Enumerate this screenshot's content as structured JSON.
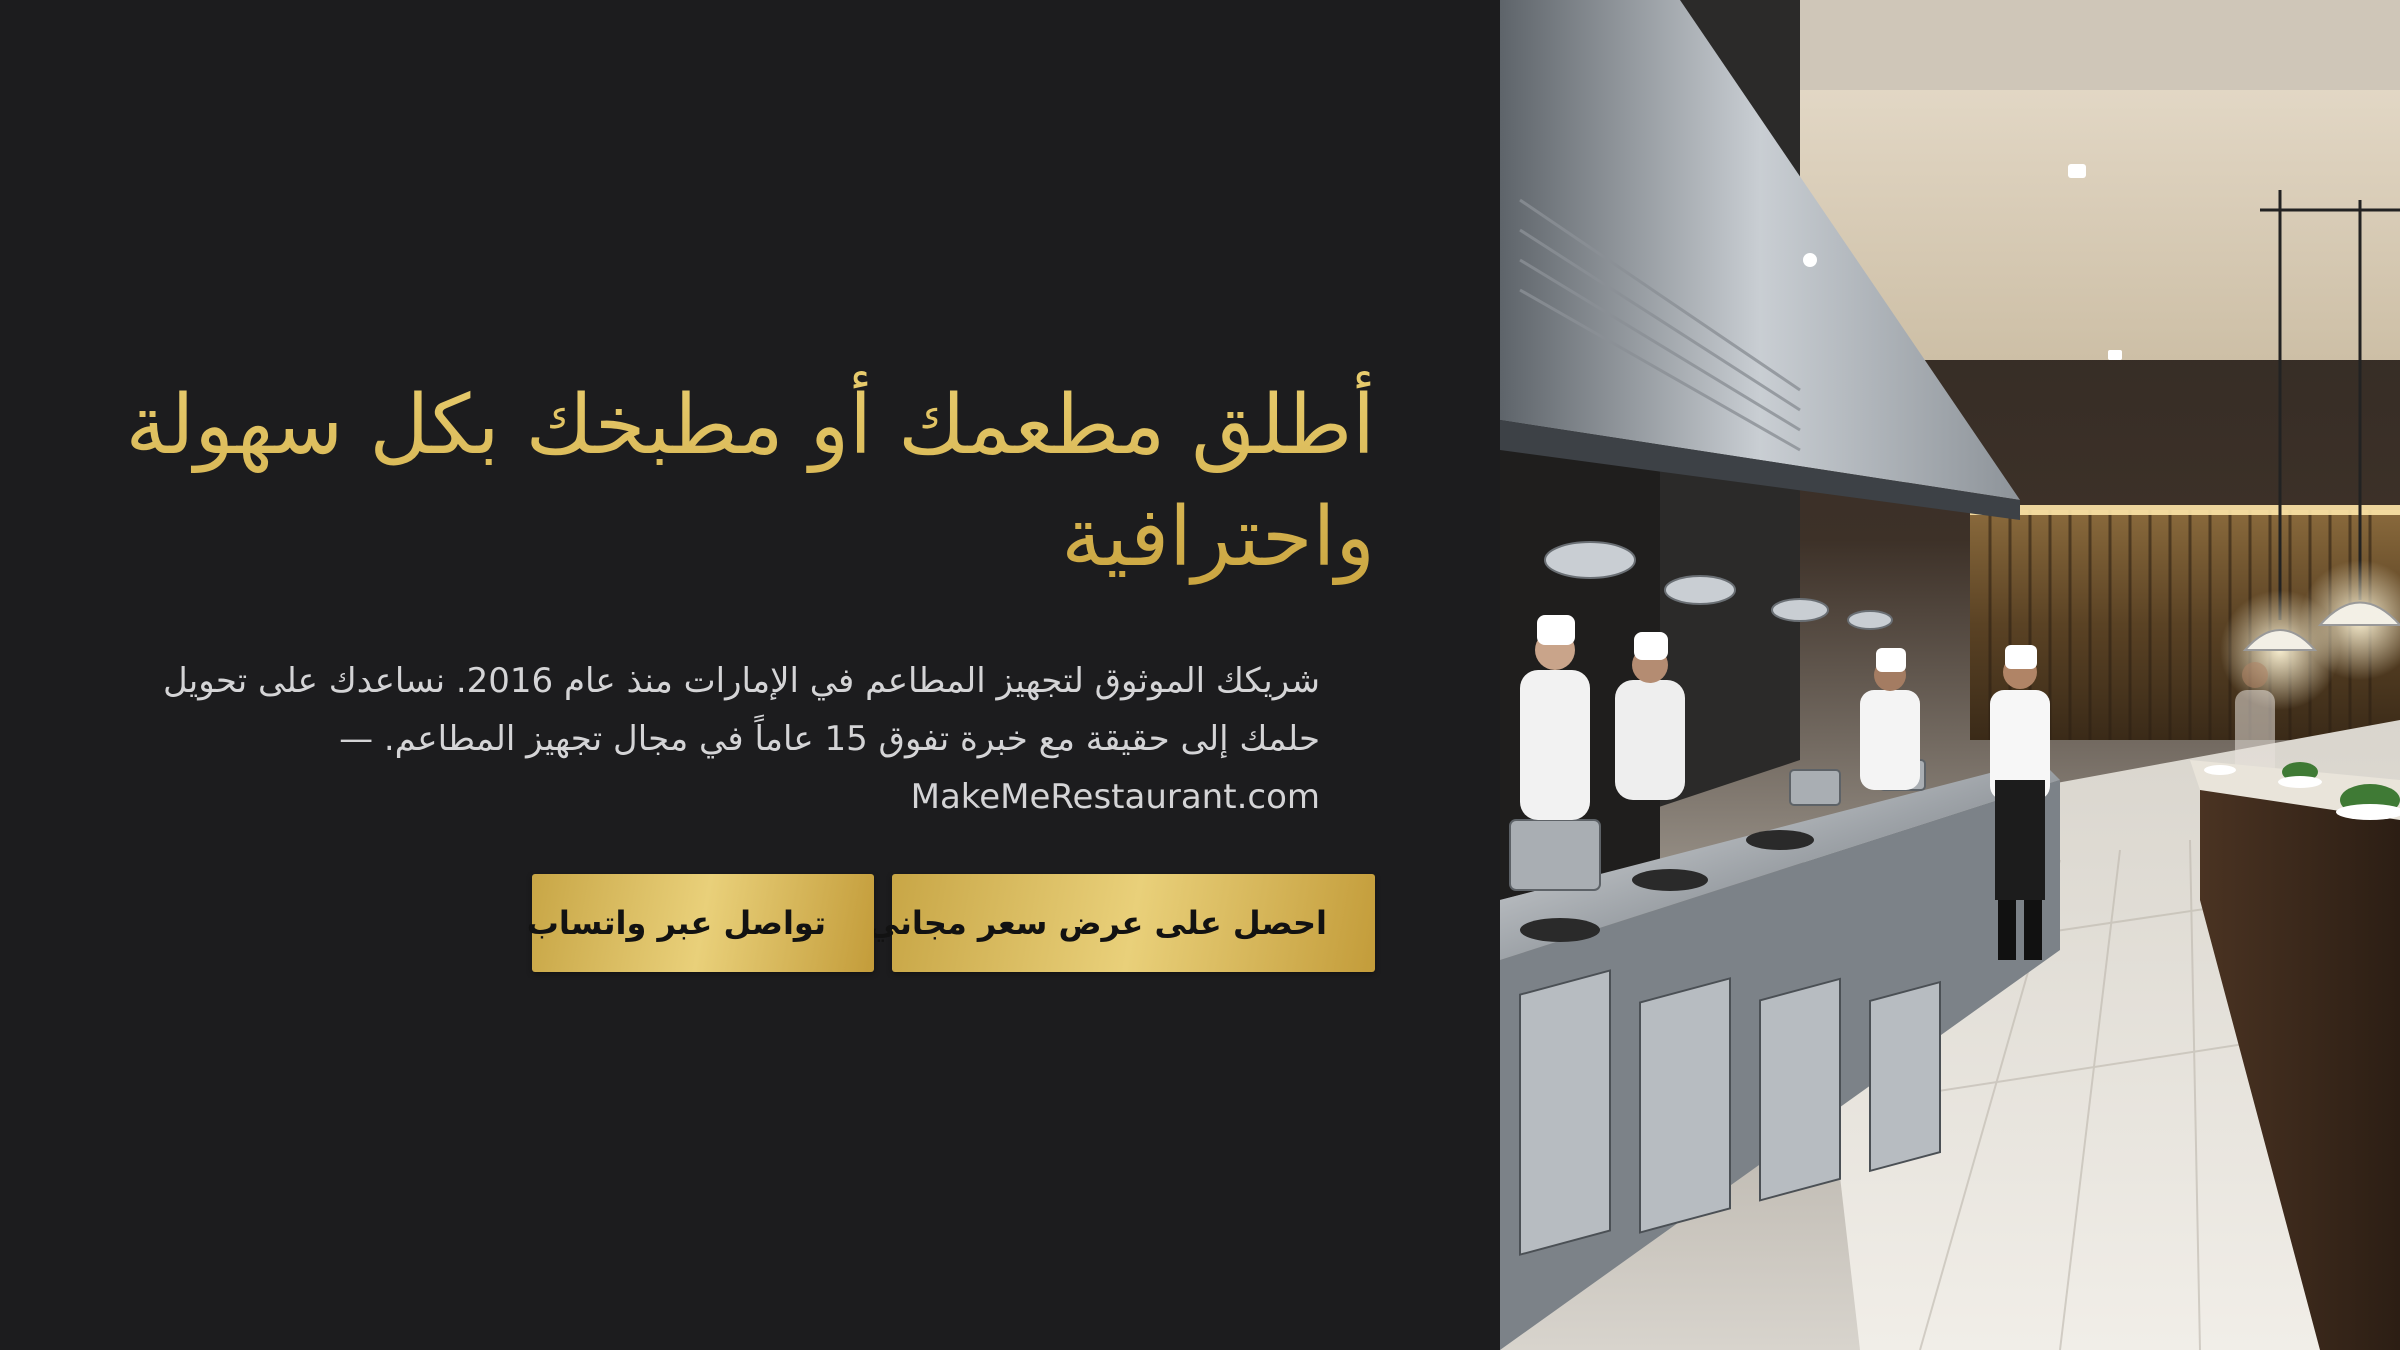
{
  "hero": {
    "title": "أطلق مطعمك أو مطبخك بكل سهولة واحترافية",
    "description": "شريكك الموثوق لتجهيز المطاعم في الإمارات منذ عام 2016. نساعدك على تحويل حلمك إلى حقيقة مع خبرة تفوق 15 عاماً في مجال تجهيز المطاعم. — MakeMeRestaurant.com",
    "primary_button": "احصل على عرض سعر مجاني",
    "secondary_button": "تواصل عبر واتساب"
  },
  "colors": {
    "background": "#1c1c1e",
    "accent_gold": "#d6b85a",
    "text_light": "#d4d4d6",
    "button_text": "#121212"
  }
}
